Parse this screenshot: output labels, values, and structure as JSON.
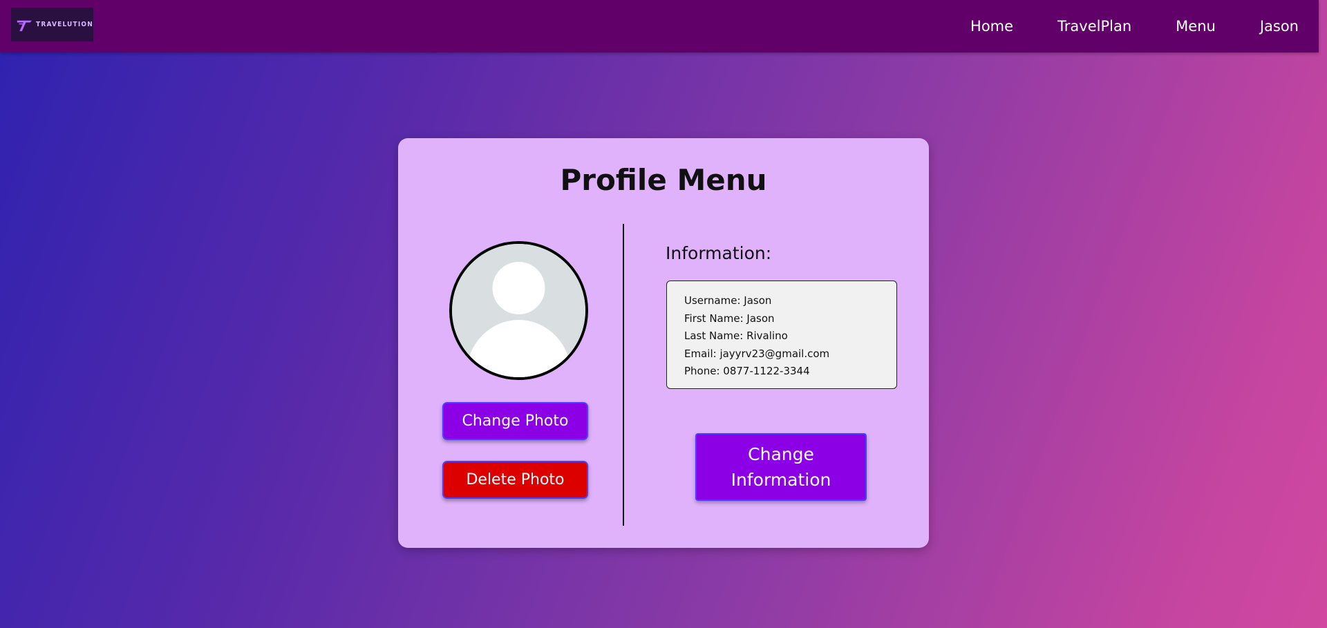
{
  "navbar": {
    "logo_text": "TRAVELUTION",
    "links": [
      {
        "label": "Home"
      },
      {
        "label": "TravelPlan"
      },
      {
        "label": "Menu"
      },
      {
        "label": "Jason"
      }
    ]
  },
  "profile": {
    "title": "Profile Menu",
    "change_photo_label": "Change Photo",
    "delete_photo_label": "Delete Photo",
    "info_heading": "Information:",
    "info_lines": [
      "Username: Jason",
      "First Name: Jason",
      "Last Name: Rivalino",
      "Email: jayyrv23@gmail.com",
      "Phone: 0877-1122-3344"
    ],
    "change_info_line1": "Change",
    "change_info_line2": "Information"
  },
  "colors": {
    "navbar": "#620069",
    "card": "#e0b2fb",
    "primary_button": "#8b00e4",
    "danger_button": "#dd0000"
  },
  "icons": {
    "logo": "travelution-logo-icon",
    "avatar": "default-avatar-icon"
  }
}
